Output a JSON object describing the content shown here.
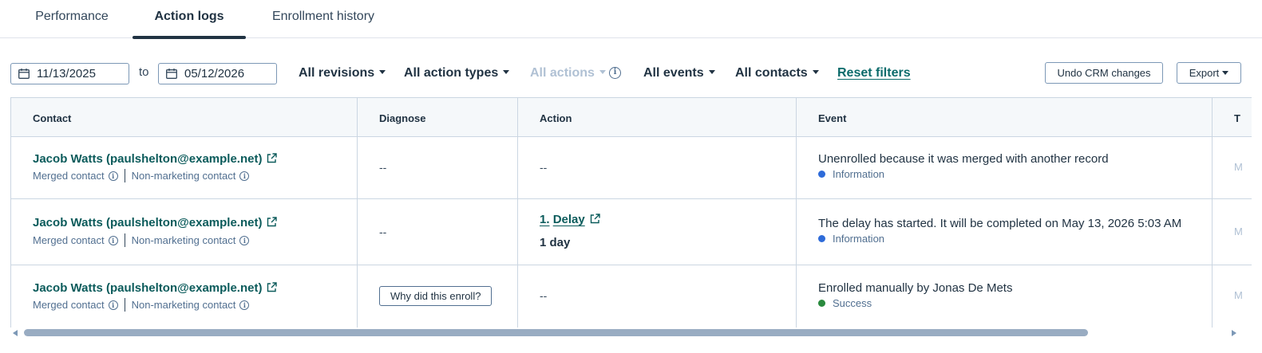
{
  "tabs": [
    {
      "label": "Performance"
    },
    {
      "label": "Action logs"
    },
    {
      "label": "Enrollment history"
    }
  ],
  "filters": {
    "date_from": "11/13/2025",
    "to_label": "to",
    "date_to": "05/12/2026",
    "revisions": "All revisions",
    "action_types": "All action types",
    "actions": "All actions",
    "events": "All events",
    "contacts": "All contacts",
    "reset": "Reset filters",
    "undo": "Undo CRM changes",
    "export": "Export"
  },
  "table": {
    "headers": [
      "Contact",
      "Diagnose",
      "Action",
      "Event",
      "T"
    ],
    "rows": [
      {
        "contact": "Jacob Watts (paulshelton@example.net)",
        "tag1": "Merged contact",
        "tag2": "Non-marketing contact",
        "diagnose": "--",
        "action": "--",
        "event": "Unenrolled because it was merged with another record",
        "status": "Information",
        "trunc": "M"
      },
      {
        "contact": "Jacob Watts (paulshelton@example.net)",
        "tag1": "Merged contact",
        "tag2": "Non-marketing contact",
        "diagnose": "--",
        "action_num": "1.",
        "action_name": "Delay",
        "action_detail": "1 day",
        "event": "The delay has started. It will be completed on May 13, 2026 5:03 AM",
        "status": "Information",
        "trunc": "M"
      },
      {
        "contact": "Jacob Watts (paulshelton@example.net)",
        "tag1": "Merged contact",
        "tag2": "Non-marketing contact",
        "diagnose_button": "Why did this enroll?",
        "action": "--",
        "event": "Enrolled manually by Jonas De Mets",
        "status": "Success",
        "trunc": "M"
      }
    ]
  },
  "colors": {
    "information": "#2e6bd9",
    "success": "#2a8a3e",
    "link": "#0b5b5b"
  }
}
